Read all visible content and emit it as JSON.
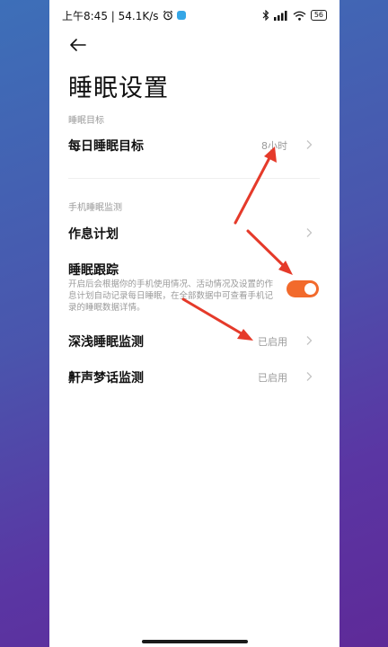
{
  "status_bar": {
    "time_speed": "上午8:45 | 54.1K/s",
    "battery": "56"
  },
  "page": {
    "title": "睡眠设置"
  },
  "sections": {
    "sleep_goal": {
      "label": "睡眠目标",
      "items": [
        {
          "label": "每日睡眠目标",
          "value": "8小时"
        }
      ]
    },
    "phone_monitor": {
      "label": "手机睡眠监测",
      "schedule": {
        "label": "作息计划"
      },
      "tracking": {
        "label": "睡眠跟踪",
        "description": "开启后会根据你的手机使用情况、活动情况及设置的作息计划自动记录每日睡眠，在全部数据中可查看手机记录的睡眠数据详情。",
        "enabled": true
      },
      "deep_light": {
        "label": "深浅睡眠监测",
        "value": "已启用"
      },
      "snore_talk": {
        "label": "鼾声梦话监测",
        "value": "已启用"
      }
    }
  },
  "colors": {
    "accent": "#f26a2c",
    "annotation_arrow": "#e53a2a"
  }
}
